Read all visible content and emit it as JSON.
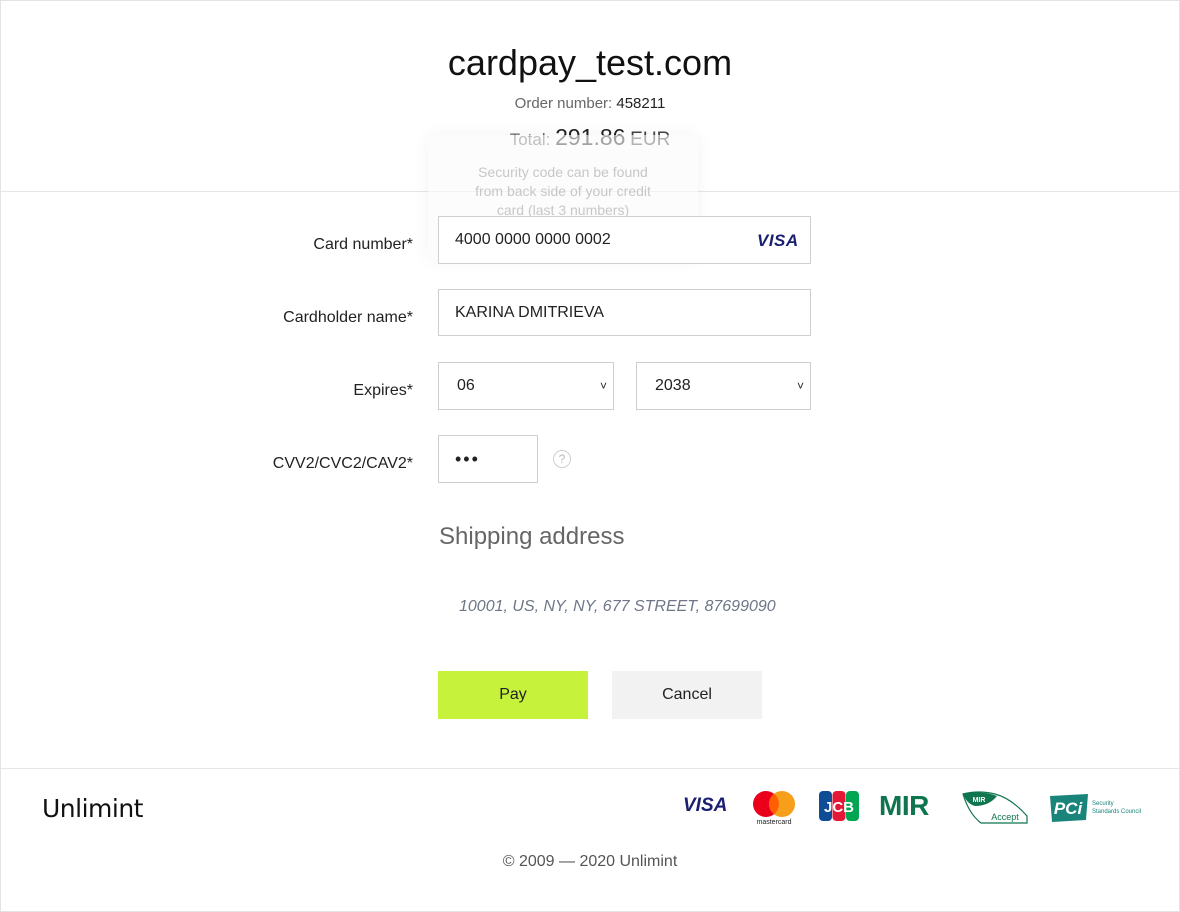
{
  "header": {
    "site_title": "cardpay_test.com",
    "order_label": "Order number:",
    "order_number": "458211",
    "total_label": "Total:",
    "total_amount": "291.86",
    "currency": "EUR"
  },
  "tooltip": {
    "text": "Security code can be found from back side of your credit card (last 3 numbers)"
  },
  "form": {
    "card_number_label": "Card number*",
    "card_number_value": "4000 0000 0000 0002",
    "card_brand": "VISA",
    "cardholder_label": "Cardholder name*",
    "cardholder_value": "KARINA DMITRIEVA",
    "expires_label": "Expires*",
    "expires_month": "06",
    "expires_year": "2038",
    "cvv_label": "CVV2/CVC2/CAV2*",
    "cvv_value": "•••",
    "help_glyph": "?"
  },
  "shipping": {
    "title": "Shipping address",
    "address": "10001, US, NY, NY, 677 STREET, 87699090"
  },
  "actions": {
    "pay_label": "Pay",
    "cancel_label": "Cancel"
  },
  "footer": {
    "brand": "Unlimint",
    "copyright": "© 2009 — 2020 Unlimint",
    "payment_logos": {
      "visa": "VISA",
      "mastercard": "mastercard",
      "jcb": "JCB",
      "mir": "MIR",
      "mir_accept": "Accept",
      "mir_small": "MIR",
      "pci": "PCi",
      "pci_sub1": "Security",
      "pci_sub2": "Standards Council"
    }
  },
  "colors": {
    "pay_button": "#c6f23b",
    "cancel_button": "#f2f2f2",
    "visa_blue": "#1a1f71",
    "mir_green": "#0f754e",
    "pci_teal": "#19847a"
  }
}
